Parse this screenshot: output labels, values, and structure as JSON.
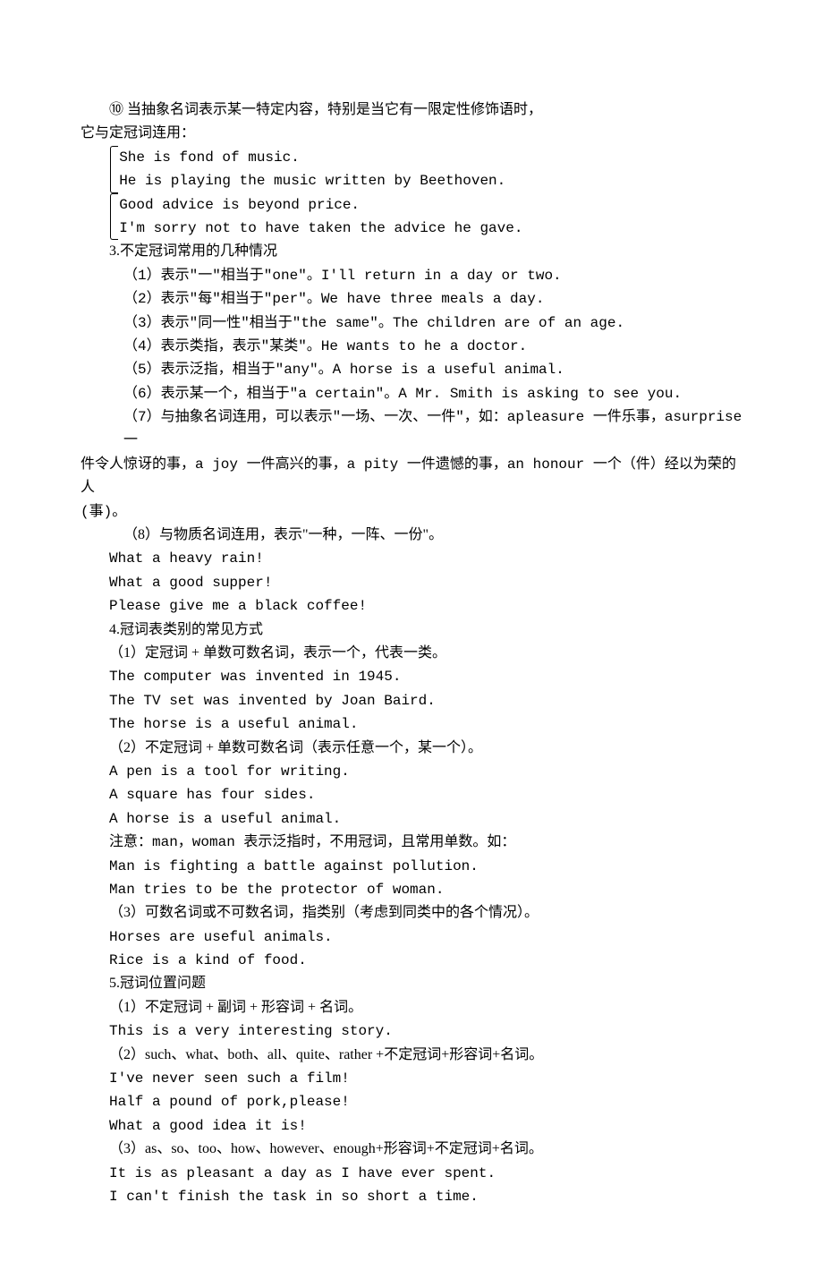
{
  "p0": "⑩ 当抽象名词表示某一特定内容，特别是当它有一限定性修饰语时，",
  "p1": "它与定冠词连用：",
  "brace1": {
    "l1": "She is fond of music.",
    "l2": "He is playing the music written by Beethoven."
  },
  "brace2": {
    "l1": "Good advice is beyond price.",
    "l2": "I'm sorry not to have taken the advice he gave."
  },
  "s3_title": "3.不定冠词常用的几种情况",
  "s3_1": "（1）表示\"一\"相当于\"one\"。I'll return in a day or two.",
  "s3_2": "（2）表示\"每\"相当于\"per\"。We have three meals a day.",
  "s3_3": "（3）表示\"同一性\"相当于\"the same\"。The children are of an age.",
  "s3_4": "（4）表示类指，表示\"某类\"。He wants to he a doctor.",
  "s3_5": "（5）表示泛指，相当于\"any\"。A horse is a useful animal.",
  "s3_6": "（6）表示某一个，相当于\"a certain\"。A Mr. Smith is asking to see you.",
  "s3_7a": "（7）与抽象名词连用，可以表示\"一场、一次、一件\"，如：apleasure 一件乐事，asurprise 一",
  "s3_7b": "件令人惊讶的事，a joy 一件高兴的事，a pity 一件遗憾的事，an honour 一个（件）经以为荣的人",
  "s3_7c": "(事)。",
  "s3_8": "（8）与物质名词连用，表示\"一种，一阵、一份\"。",
  "ex1": "What a heavy rain!",
  "ex2": "What a good supper!",
  "ex3": "Please give me a black coffee!",
  "s4_title": "4.冠词表类别的常见方式",
  "s4_1": "（1）定冠词 + 单数可数名词，表示一个，代表一类。",
  "ex4": "The computer was invented in 1945.",
  "ex5": "The TV set was invented by Joan Baird.",
  "ex6": "The horse is a useful animal.",
  "s4_2": "（2）不定冠词 + 单数可数名词（表示任意一个，某一个）。",
  "ex7": "A pen is a tool for writing.",
  "ex8": "A square has four sides.",
  "ex9": "A horse is a useful animal.",
  "note1": "注意：man，woman 表示泛指时，不用冠词，且常用单数。如：",
  "ex10": "Man is fighting a battle against pollution.",
  "ex11": "Man tries to be the protector of woman.",
  "s4_3": "（3）可数名词或不可数名词，指类别（考虑到同类中的各个情况）。",
  "ex12": "Horses are useful animals.",
  "ex13": "Rice is a kind of food.",
  "s5_title": "5.冠词位置问题",
  "s5_1": "（1）不定冠词 + 副词 + 形容词 + 名词。",
  "ex14": "This is a very interesting story.",
  "s5_2": "（2）such、what、both、all、quite、rather +不定冠词+形容词+名词。",
  "ex15": "I've never seen such a film!",
  "ex16": "Half a pound of pork,please!",
  "ex17": "What a good idea it is!",
  "s5_3": "（3）as、so、too、how、however、enough+形容词+不定冠词+名词。",
  "ex18": "It is as pleasant a day as I have ever spent.",
  "ex19": "I can't finish the task in so short a time."
}
